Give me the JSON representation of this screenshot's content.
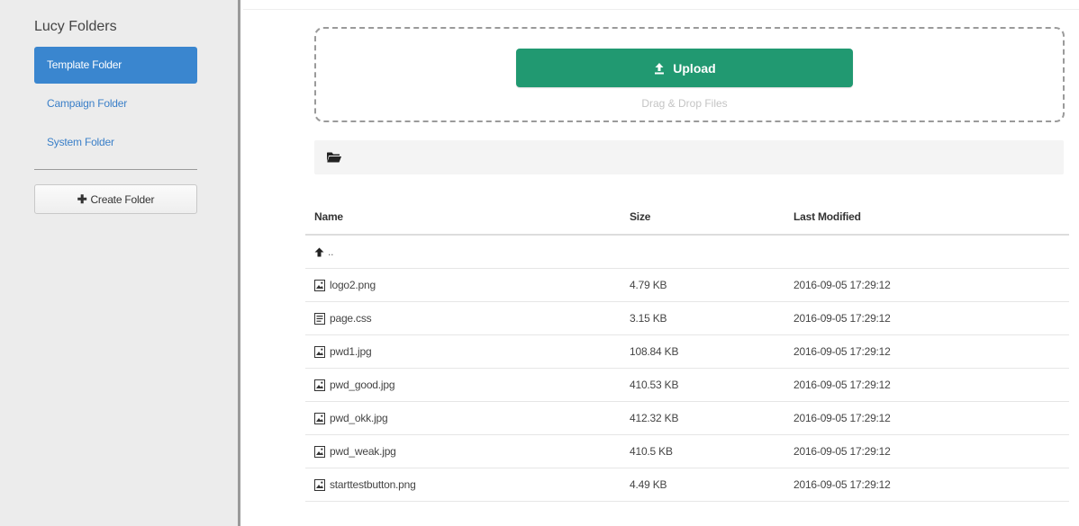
{
  "sidebar": {
    "title": "Lucy Folders",
    "folders": [
      {
        "label": "Template Folder",
        "active": true
      },
      {
        "label": "Campaign Folder",
        "active": false
      },
      {
        "label": "System Folder",
        "active": false
      }
    ],
    "create_folder_label": "Create Folder"
  },
  "upload": {
    "button_label": "Upload",
    "drop_hint": "Drag & Drop Files",
    "button_color": "#219971"
  },
  "breadcrumb": {
    "icon": "folder-open-icon"
  },
  "table": {
    "headers": {
      "name": "Name",
      "size": "Size",
      "modified": "Last Modified"
    },
    "parent_label": "..",
    "rows": [
      {
        "name": "logo2.png",
        "size": "4.79 KB",
        "modified": "2016-09-05 17:29:12",
        "icon": "image-file-icon"
      },
      {
        "name": "page.css",
        "size": "3.15 KB",
        "modified": "2016-09-05 17:29:12",
        "icon": "text-file-icon"
      },
      {
        "name": "pwd1.jpg",
        "size": "108.84 KB",
        "modified": "2016-09-05 17:29:12",
        "icon": "image-file-icon"
      },
      {
        "name": "pwd_good.jpg",
        "size": "410.53 KB",
        "modified": "2016-09-05 17:29:12",
        "icon": "image-file-icon"
      },
      {
        "name": "pwd_okk.jpg",
        "size": "412.32 KB",
        "modified": "2016-09-05 17:29:12",
        "icon": "image-file-icon"
      },
      {
        "name": "pwd_weak.jpg",
        "size": "410.5 KB",
        "modified": "2016-09-05 17:29:12",
        "icon": "image-file-icon"
      },
      {
        "name": "starttestbutton.png",
        "size": "4.49 KB",
        "modified": "2016-09-05 17:29:12",
        "icon": "image-file-icon"
      }
    ]
  },
  "colors": {
    "accent": "#3a86cf",
    "link": "#3a7fc8",
    "sidebar_bg": "#ececec"
  }
}
